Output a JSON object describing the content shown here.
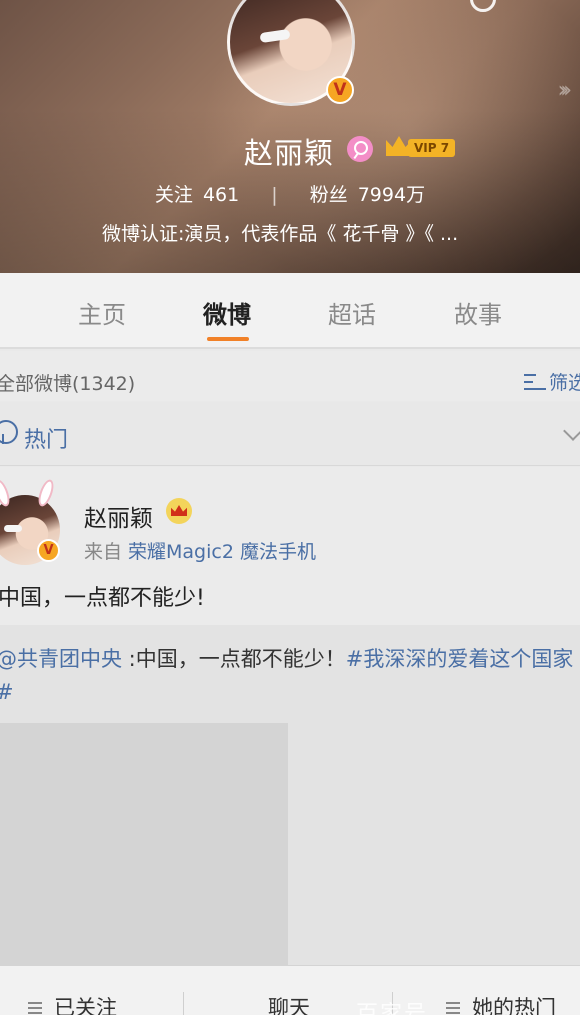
{
  "profile": {
    "name": "赵丽颖",
    "vip_label": "VIP 7",
    "verified_badge": "V",
    "following_label": "关注",
    "following_count": "461",
    "stats_separator": "|",
    "followers_label": "粉丝",
    "followers_count": "7994万",
    "verification": "微博认证:演员，代表作品《 花千骨 》《 ...",
    "more_icon": "chevrons-right-icon"
  },
  "tabs": [
    {
      "label": "主页",
      "active": false
    },
    {
      "label": "微博",
      "active": true
    },
    {
      "label": "超话",
      "active": false
    },
    {
      "label": "故事",
      "active": false
    }
  ],
  "accent_color": "#f18128",
  "link_color": "#4a6fa5",
  "filter": {
    "title": "全部微博(1342)",
    "button_label": "筛选"
  },
  "hot": {
    "label": "热门"
  },
  "post": {
    "author": "赵丽颖",
    "verified_badge": "V",
    "source_prefix": "来自",
    "device": "荣耀Magic2 魔法手机",
    "text": "中国，一点都不能少!",
    "repost": {
      "mention": "@共青团中央",
      "body": " :中国，一点都不能少！",
      "hashtag": "#我深深的爱着这个国家#"
    }
  },
  "bottom_bar": {
    "follow_label": "已关注",
    "chat_label": "聊天",
    "hot_label": "她的热门",
    "watermark": "百家号"
  }
}
